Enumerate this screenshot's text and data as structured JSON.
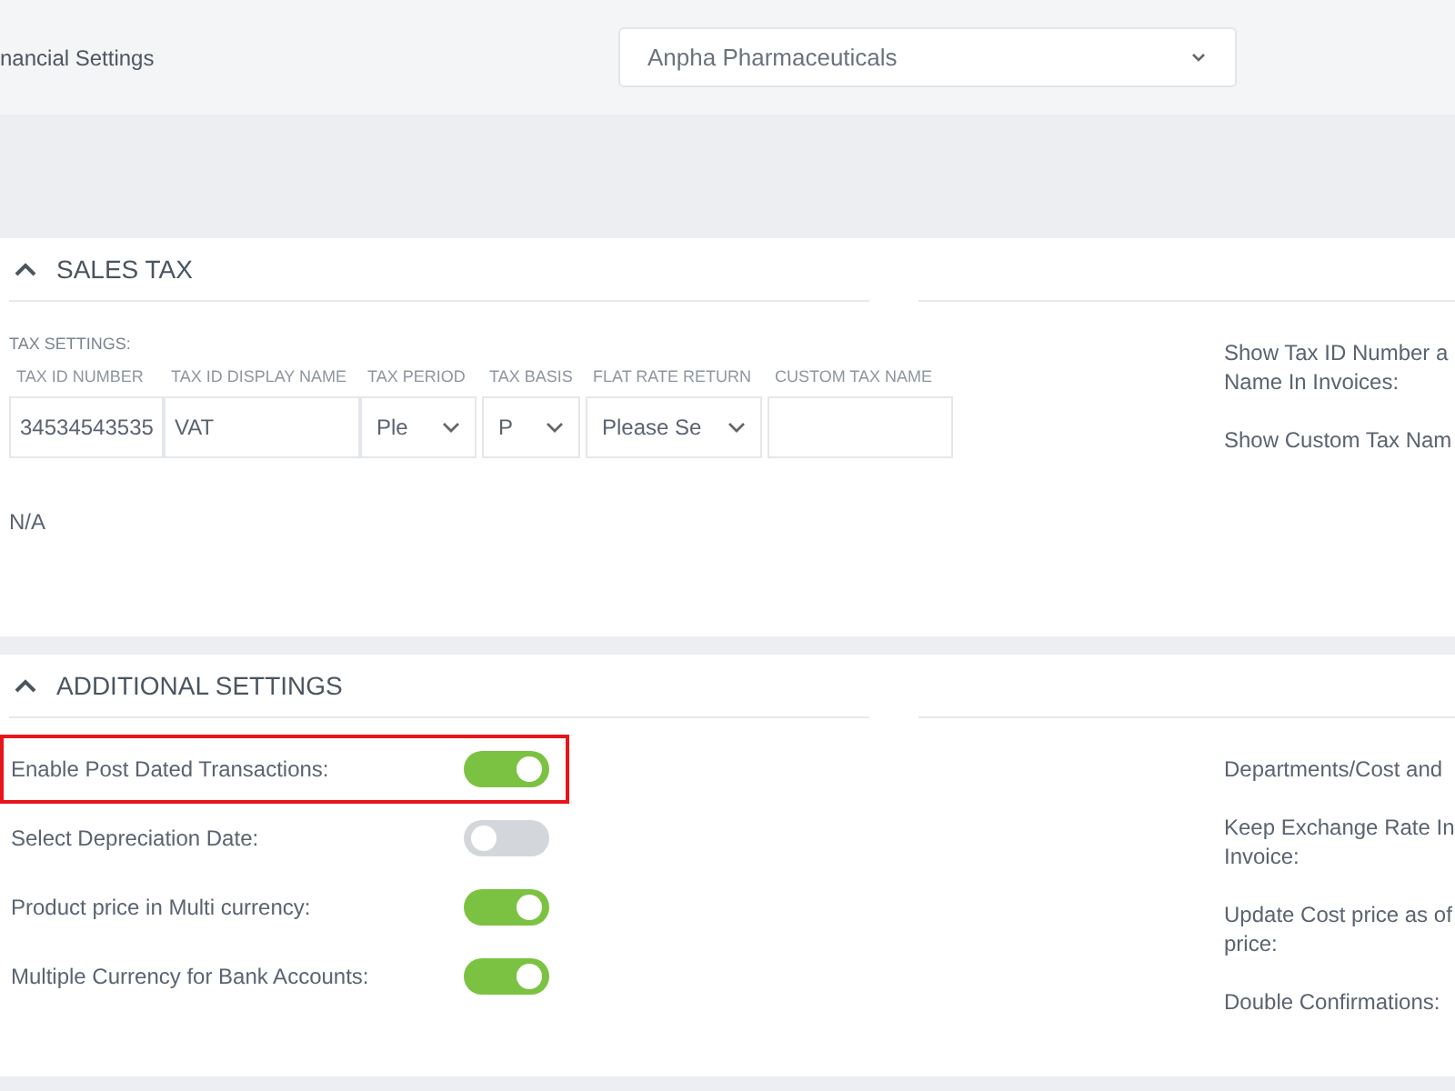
{
  "header": {
    "title": "nancial Settings",
    "company_select": {
      "value": "Anpha Pharmaceuticals"
    }
  },
  "sales_tax": {
    "title": "SALES TAX",
    "expanded": true,
    "group_label": "TAX SETTINGS:",
    "columns": [
      {
        "label": "TAX ID NUMBER",
        "kind": "input",
        "value": "34534543535"
      },
      {
        "label": "TAX ID DISPLAY NAME",
        "kind": "input",
        "value": "VAT"
      },
      {
        "label": "TAX PERIOD",
        "kind": "select",
        "value": "Ple"
      },
      {
        "label": "TAX BASIS",
        "kind": "select",
        "value": "P"
      },
      {
        "label": "FLAT RATE RETURN",
        "kind": "select",
        "value": "Please Se"
      },
      {
        "label": "CUSTOM TAX NAME",
        "kind": "input"
      }
    ],
    "note": "N/A",
    "right_labels": [
      {
        "lines": [
          "Show Tax ID Number a",
          "Name In Invoices:"
        ]
      },
      {
        "lines": [
          "Show Custom Tax Nam"
        ]
      }
    ]
  },
  "additional_settings": {
    "title": "ADDITIONAL SETTINGS",
    "expanded": true,
    "toggles": [
      {
        "label": "Enable Post Dated Transactions:",
        "on": true,
        "highlighted": true
      },
      {
        "label": "Select Depreciation Date:",
        "on": false,
        "highlighted": false
      },
      {
        "label": "Product price in Multi currency:",
        "on": true,
        "highlighted": false
      },
      {
        "label": "Multiple Currency for Bank Accounts:",
        "on": true,
        "highlighted": false
      }
    ],
    "right_labels": [
      {
        "lines": [
          "Departments/Cost and"
        ]
      },
      {
        "lines": [
          "Keep Exchange Rate In",
          "Invoice:"
        ]
      },
      {
        "lines": [
          "Update Cost price as of",
          "price:"
        ]
      },
      {
        "lines": [
          "Double Confirmations:"
        ]
      }
    ]
  }
}
